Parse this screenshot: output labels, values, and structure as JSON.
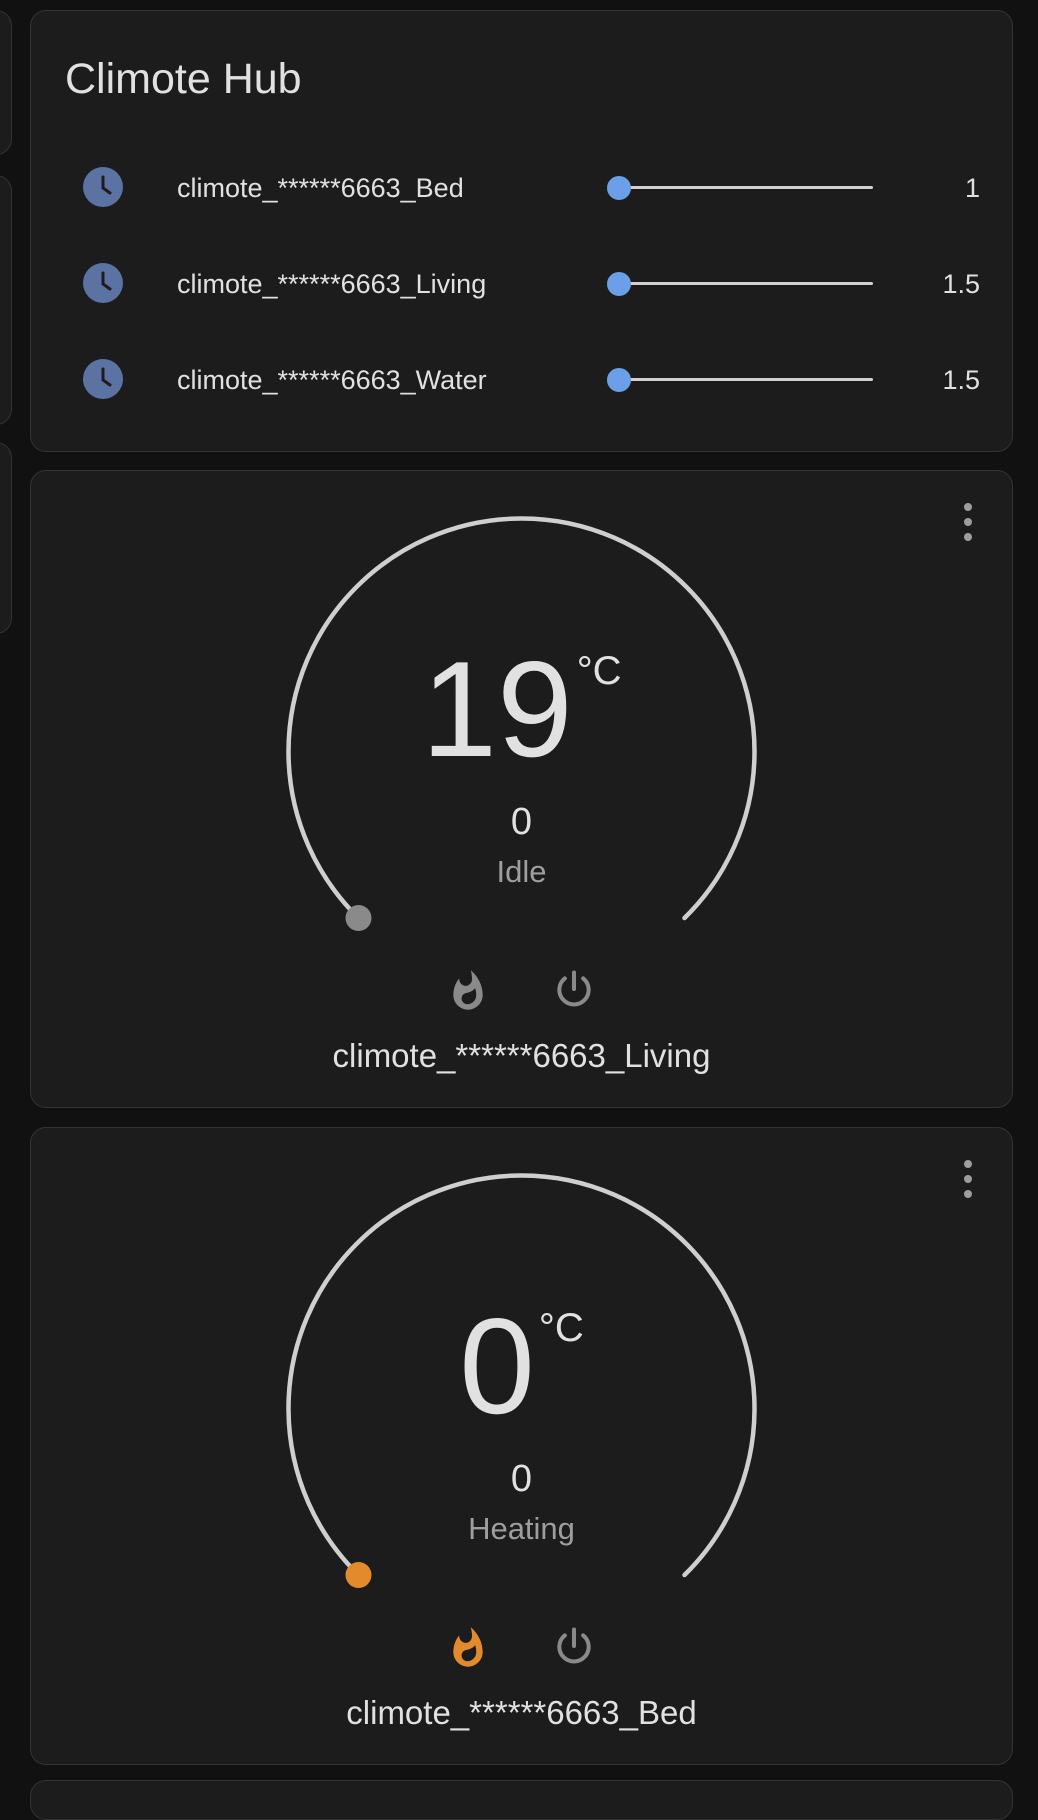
{
  "hub": {
    "title": "Climote Hub",
    "rows": [
      {
        "label": "climote_******6663_Bed",
        "value": "1",
        "slider_fraction": 0.0,
        "icon": "clock-icon"
      },
      {
        "label": "climote_******6663_Living",
        "value": "1.5",
        "slider_fraction": 0.0,
        "icon": "clock-icon"
      },
      {
        "label": "climote_******6663_Water",
        "value": "1.5",
        "slider_fraction": 0.0,
        "icon": "clock-icon"
      }
    ],
    "accent": "#6b9fe8"
  },
  "thermostats": [
    {
      "temperature": "19",
      "unit": "°C",
      "target": "0",
      "state": "Idle",
      "name": "climote_******6663_Living",
      "heating": false
    },
    {
      "temperature": "0",
      "unit": "°C",
      "target": "0",
      "state": "Heating",
      "name": "climote_******6663_Bed",
      "heating": true
    }
  ],
  "colors": {
    "heating_active": "#e38b2c",
    "idle_dot": "#8a8a8a",
    "arc": "#cfcfcf"
  }
}
